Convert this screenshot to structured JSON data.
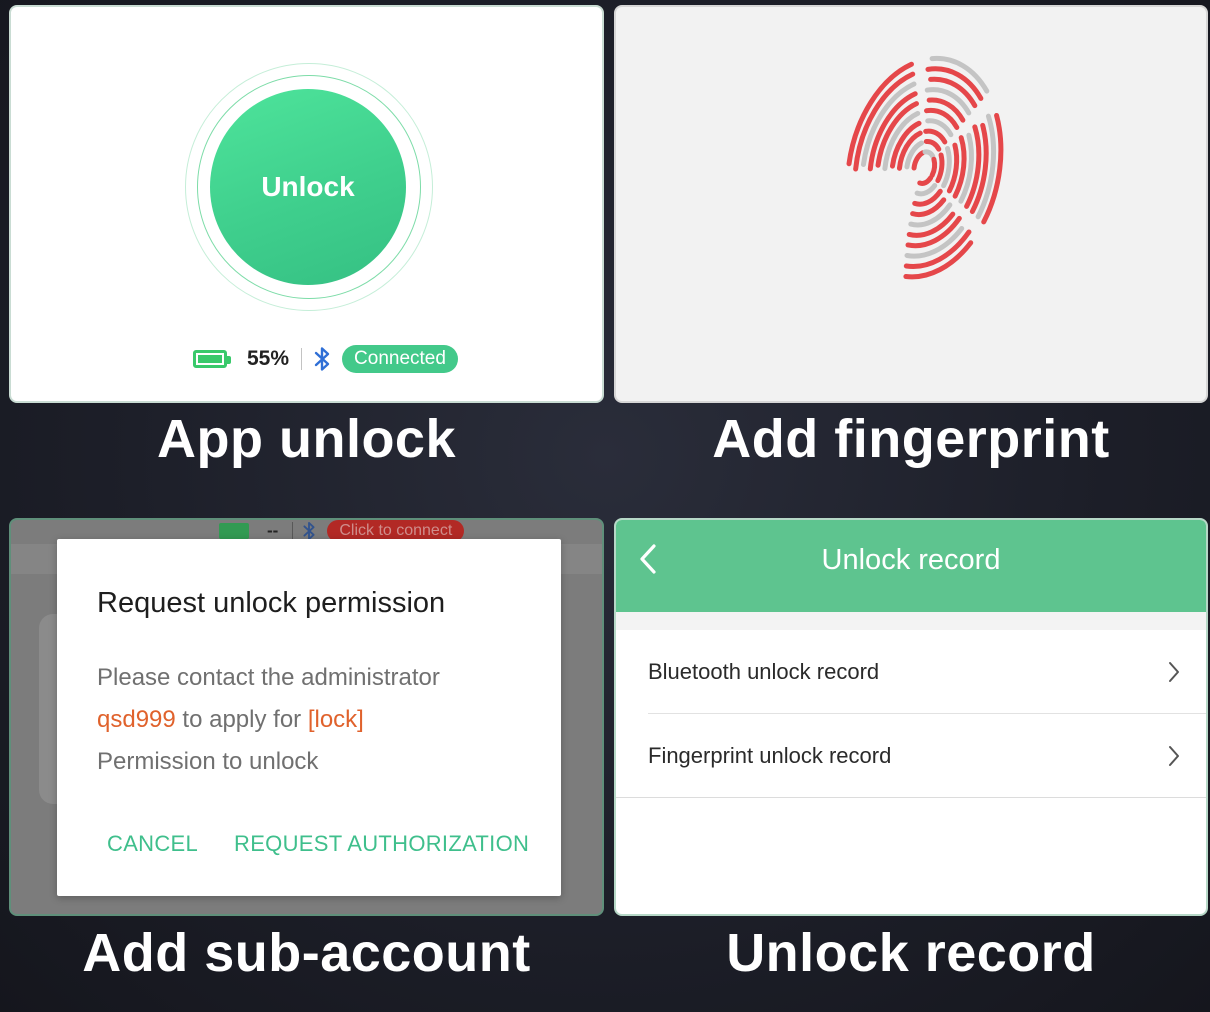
{
  "panels": {
    "app_unlock": {
      "button_label": "Unlock",
      "battery_percent": "55%",
      "battery_level": 0.55,
      "connection_status": "Connected",
      "caption": "App unlock"
    },
    "add_fingerprint": {
      "caption": "Add fingerprint"
    },
    "sub_account": {
      "background_status": {
        "battery_value": "--",
        "connect_label": "Click to connect"
      },
      "dialog": {
        "title": "Request unlock permission",
        "line1": "Please contact the administrator",
        "admin_name": "qsd999",
        "line2_middle": " to apply for ",
        "lock_name": "[lock]",
        "line3": "Permission to unlock",
        "cancel_label": "CANCEL",
        "request_label": "REQUEST AUTHORIZATION"
      },
      "caption": "Add sub-account"
    },
    "unlock_record": {
      "header_title": "Unlock record",
      "items": [
        {
          "label": "Bluetooth unlock record"
        },
        {
          "label": "Fingerprint unlock record"
        }
      ],
      "caption": "Unlock record"
    }
  },
  "colors": {
    "accent_green": "#3fcf8d",
    "header_green": "#5ec48f",
    "highlight_orange": "#e0622c",
    "fingerprint_red": "#e5474a",
    "fingerprint_gray": "#c4c4c4",
    "disconnected_red": "#b8211c"
  },
  "icons": [
    "battery-icon",
    "bluetooth-icon",
    "fingerprint-icon",
    "back-chevron-icon",
    "chevron-right-icon"
  ]
}
